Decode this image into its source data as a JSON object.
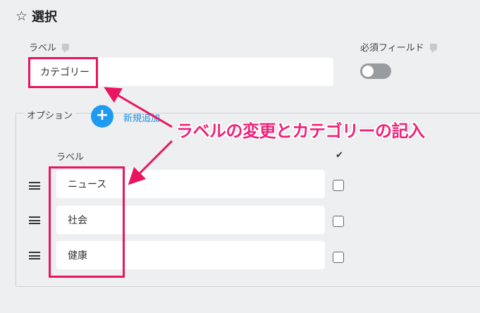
{
  "header": {
    "star_icon": "☆",
    "title": "選択"
  },
  "label_field": {
    "label": "ラベル",
    "value": "カテゴリー"
  },
  "required_field": {
    "label": "必須フィールド",
    "toggle_on": false
  },
  "options": {
    "legend": "オプション",
    "add_icon": "+",
    "add_link": "新規追加",
    "column_label": "ラベル",
    "check_header": "✔",
    "items": [
      {
        "label": "ニュース",
        "checked": false
      },
      {
        "label": "社会",
        "checked": false
      },
      {
        "label": "健康",
        "checked": false
      }
    ]
  },
  "annotation": {
    "text": "ラベルの変更とカテゴリーの記入",
    "color": "#e8155f"
  }
}
